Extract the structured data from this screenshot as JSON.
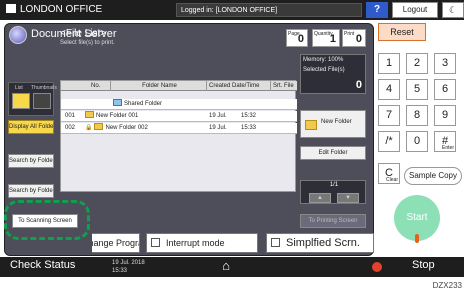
{
  "topbar": {
    "title": "LONDON OFFICE",
    "login": "Logged in: [LONDON OFFICE]",
    "help": "?",
    "logout": "Logout",
    "moon": "☾"
  },
  "app": {
    "title": "Document Server",
    "filelist_title": "<File List>",
    "filelist_sub": "Select file(s) to print.",
    "counters": {
      "page": {
        "label": "Page",
        "value": "0"
      },
      "quantity": {
        "label": "Quantity",
        "value": "1"
      },
      "print": {
        "label": "Print",
        "value": "0"
      }
    },
    "view": {
      "list": "List",
      "thumbnails": "Thumbnails"
    },
    "sidebar": {
      "display_all": "Display All Folders",
      "search_no": "Search by Folder No.",
      "search_name": "Search by Folder Name",
      "to_scanning": "To Scanning Screen"
    },
    "table": {
      "headers": [
        "No.",
        "Folder Name",
        "Created Date/Time",
        "Srt. File"
      ],
      "rows": [
        {
          "no": "",
          "name": "Shared Folder",
          "date": "",
          "time": ""
        },
        {
          "no": "001",
          "name": "New Folder 001",
          "date": "19 Jul.",
          "time": "15:32"
        },
        {
          "no": "002",
          "name": "New Folder 002",
          "date": "19 Jul.",
          "time": "15:33"
        }
      ]
    },
    "right": {
      "memory": "Memory: 100%",
      "selected": "Selected File(s)",
      "selected_val": "0",
      "new_folder": "New Folder",
      "edit_folder": "Edit Folder",
      "page_ind": "1/1",
      "up": "▲",
      "down": "▼",
      "to_printing": "To Printing Screen"
    }
  },
  "bottom": {
    "change_program": "Change Program",
    "interrupt": "Interrupt mode",
    "simplified": "Simplfied Scrn."
  },
  "numpad": {
    "reset": "Reset",
    "keys": [
      "1",
      "2",
      "3",
      "4",
      "5",
      "6",
      "7",
      "8",
      "9",
      "/*",
      "0",
      "#"
    ],
    "enter": "Enter",
    "clear_main": "C",
    "clear_sub": "Clear",
    "sample_copy": "Sample Copy",
    "start": "Start"
  },
  "status": {
    "label": "Check Status",
    "date": "19 Jul. 2018",
    "time": "15:33",
    "stop": "Stop"
  },
  "code": "DZX233"
}
